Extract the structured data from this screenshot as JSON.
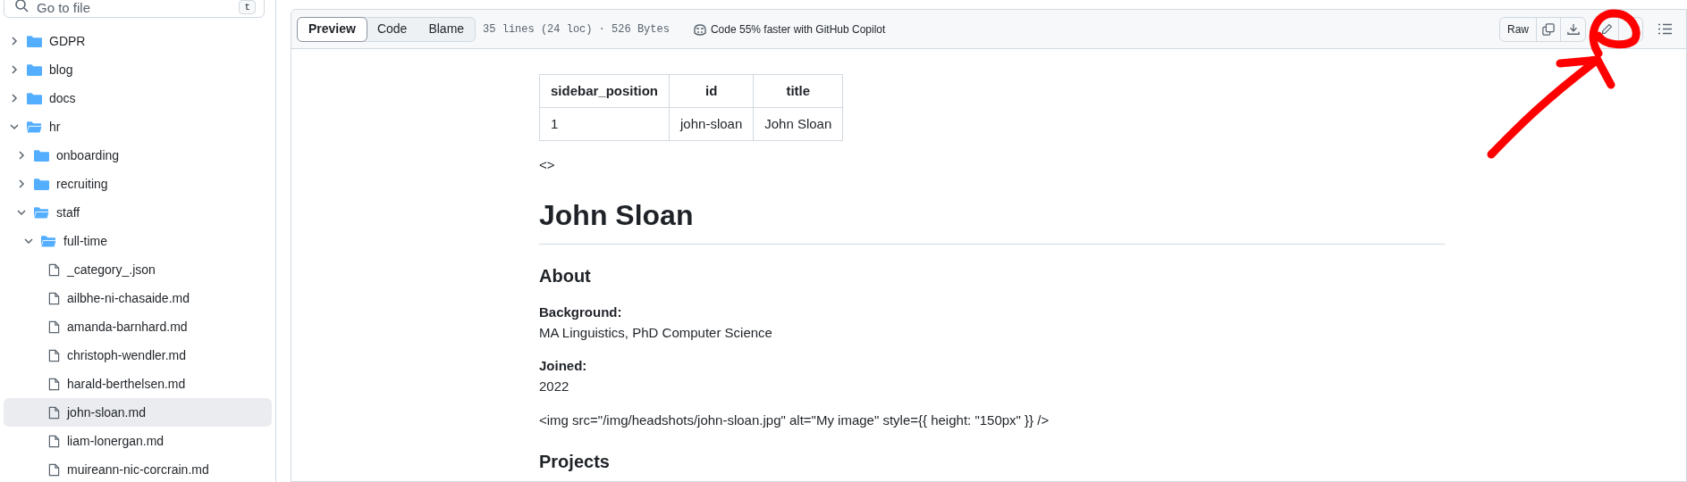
{
  "search": {
    "placeholder": "Go to file",
    "shortcut": "t"
  },
  "tree": [
    {
      "kind": "folder",
      "name": "GDPR",
      "expanded": false
    },
    {
      "kind": "folder",
      "name": "blog",
      "expanded": false
    },
    {
      "kind": "folder",
      "name": "docs",
      "expanded": false
    },
    {
      "kind": "folder",
      "name": "hr",
      "expanded": true,
      "children": [
        {
          "kind": "folder",
          "name": "onboarding",
          "expanded": false
        },
        {
          "kind": "folder",
          "name": "recruiting",
          "expanded": false
        },
        {
          "kind": "folder",
          "name": "staff",
          "expanded": true,
          "children": [
            {
              "kind": "folder",
              "name": "full-time",
              "expanded": true,
              "children": [
                {
                  "kind": "file",
                  "name": "_category_.json",
                  "selected": false
                },
                {
                  "kind": "file",
                  "name": "ailbhe-ni-chasaide.md",
                  "selected": false
                },
                {
                  "kind": "file",
                  "name": "amanda-barnhard.md",
                  "selected": false
                },
                {
                  "kind": "file",
                  "name": "christoph-wendler.md",
                  "selected": false
                },
                {
                  "kind": "file",
                  "name": "harald-berthelsen.md",
                  "selected": false
                },
                {
                  "kind": "file",
                  "name": "john-sloan.md",
                  "selected": true
                },
                {
                  "kind": "file",
                  "name": "liam-lonergan.md",
                  "selected": false
                },
                {
                  "kind": "file",
                  "name": "muireann-nic-corcrain.md",
                  "selected": false
                }
              ]
            }
          ]
        }
      ]
    }
  ],
  "view_tabs": [
    {
      "label": "Preview",
      "selected": true
    },
    {
      "label": "Code",
      "selected": false
    },
    {
      "label": "Blame",
      "selected": false
    }
  ],
  "file_info": "35 lines (24 loc) · 526 Bytes",
  "copilot_promo": "Code 55% faster with GitHub Copilot",
  "raw_button": "Raw",
  "front_matter": {
    "columns": [
      "sidebar_position",
      "id",
      "title"
    ],
    "rows": [
      [
        "1",
        "john-sloan",
        "John Sloan"
      ]
    ]
  },
  "content": [
    {
      "kind": "p",
      "text": "<>"
    },
    {
      "kind": "h1",
      "text": "John Sloan"
    },
    {
      "kind": "h2",
      "text": "About"
    },
    {
      "kind": "field",
      "label": "Background:",
      "value": "MA Linguistics, PhD Computer Science"
    },
    {
      "kind": "field",
      "label": "Joined:",
      "value": "2022"
    },
    {
      "kind": "p",
      "text": "<img src=\"/img/headshots/john-sloan.jpg\" alt=\"My image\" style={{ height: \"150px\" }} />"
    },
    {
      "kind": "h2",
      "text": "Projects"
    }
  ]
}
